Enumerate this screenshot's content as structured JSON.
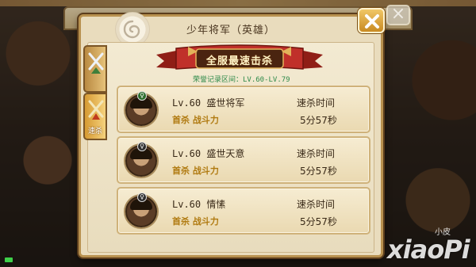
{
  "dialog": {
    "title": "少年将军（英雄）"
  },
  "side_tabs": [
    {
      "label": "",
      "icon": "crossed-swords-icon",
      "active": false
    },
    {
      "label": "速杀",
      "icon": "crossed-swords-icon",
      "active": true
    }
  ],
  "banner": {
    "text": "全服最速击杀",
    "range": "荣誉记录区间：LV.60-LV.79"
  },
  "records": [
    {
      "level": "Lv.60",
      "name": "盛世将军",
      "first_kill": "首杀 战斗力",
      "time_label": "速杀时间",
      "time_value": "5分57秒"
    },
    {
      "level": "Lv.60",
      "name": "盛世天意",
      "first_kill": "首杀 战斗力",
      "time_label": "速杀时间",
      "time_value": "5分57秒"
    },
    {
      "level": "Lv.60",
      "name": "情愫",
      "first_kill": "首杀 战斗力",
      "time_label": "速杀时间",
      "time_value": "5分57秒"
    }
  ],
  "watermark": {
    "small": "小皮",
    "big": "xiaoPi"
  },
  "colors": {
    "panel_bg": "#e9dcbd",
    "banner_red": "#b8281e",
    "range_green": "#2e8a4a",
    "first_kill_gold": "#b07a10",
    "close_gold": "#e0a83a"
  }
}
